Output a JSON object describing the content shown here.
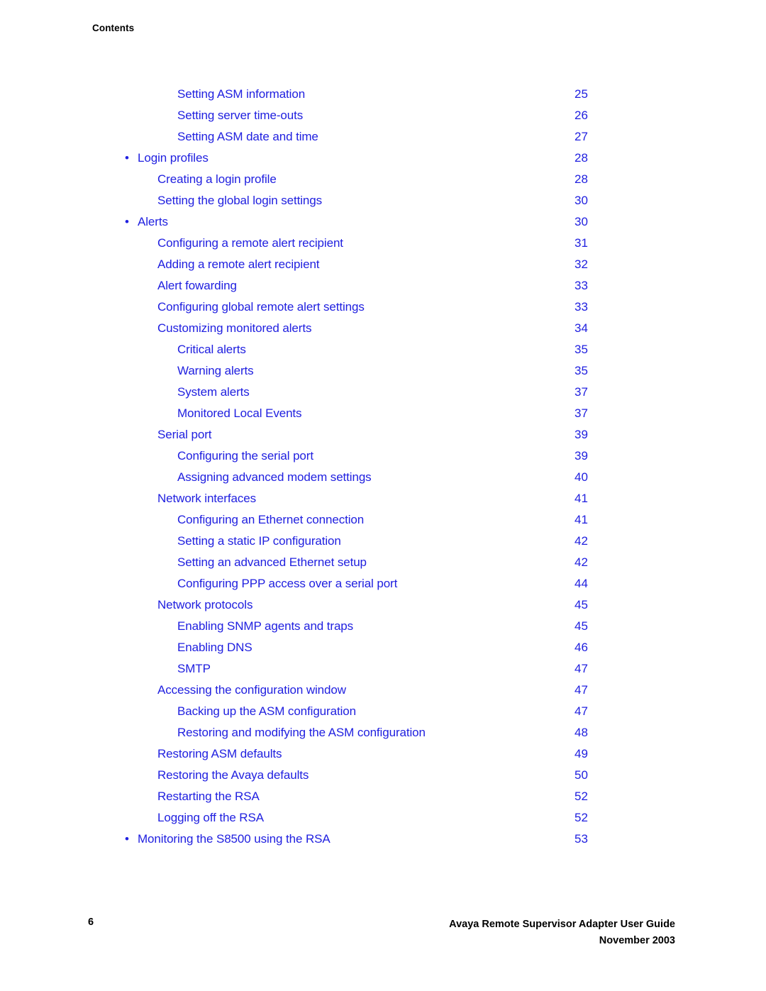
{
  "document": {
    "running_header": "Contents",
    "accent_color": "#2020e0",
    "text_color": "#000000"
  },
  "toc": {
    "entries": [
      {
        "title": "Setting ASM information",
        "page": "25",
        "level": 3,
        "bullet": false
      },
      {
        "title": "Setting server time-outs",
        "page": "26",
        "level": 3,
        "bullet": false
      },
      {
        "title": "Setting ASM date and time",
        "page": "27",
        "level": 3,
        "bullet": false
      },
      {
        "title": "Login profiles",
        "page": "28",
        "level": 1,
        "bullet": true
      },
      {
        "title": "Creating a login profile",
        "page": "28",
        "level": 2,
        "bullet": false
      },
      {
        "title": "Setting the global login settings",
        "page": "30",
        "level": 2,
        "bullet": false
      },
      {
        "title": "Alerts",
        "page": "30",
        "level": 1,
        "bullet": true
      },
      {
        "title": "Configuring a remote alert recipient",
        "page": "31",
        "level": 2,
        "bullet": false
      },
      {
        "title": "Adding a remote alert recipient",
        "page": "32",
        "level": 2,
        "bullet": false
      },
      {
        "title": "Alert fowarding",
        "page": "33",
        "level": 2,
        "bullet": false
      },
      {
        "title": "Configuring global remote alert settings",
        "page": "33",
        "level": 2,
        "bullet": false
      },
      {
        "title": "Customizing monitored alerts",
        "page": "34",
        "level": 2,
        "bullet": false
      },
      {
        "title": "Critical alerts",
        "page": "35",
        "level": 3,
        "bullet": false
      },
      {
        "title": "Warning alerts",
        "page": "35",
        "level": 3,
        "bullet": false
      },
      {
        "title": "System alerts",
        "page": "37",
        "level": 3,
        "bullet": false
      },
      {
        "title": "Monitored Local Events",
        "page": "37",
        "level": 3,
        "bullet": false
      },
      {
        "title": "Serial port",
        "page": "39",
        "level": 2,
        "bullet": false
      },
      {
        "title": "Configuring the serial port",
        "page": "39",
        "level": 3,
        "bullet": false
      },
      {
        "title": "Assigning advanced modem settings",
        "page": "40",
        "level": 3,
        "bullet": false
      },
      {
        "title": "Network interfaces",
        "page": "41",
        "level": 2,
        "bullet": false
      },
      {
        "title": "Configuring an Ethernet connection",
        "page": "41",
        "level": 3,
        "bullet": false
      },
      {
        "title": "Setting a static IP configuration",
        "page": "42",
        "level": 3,
        "bullet": false
      },
      {
        "title": "Setting an advanced Ethernet setup",
        "page": "42",
        "level": 3,
        "bullet": false
      },
      {
        "title": "Configuring PPP access over a serial port",
        "page": "44",
        "level": 3,
        "bullet": false
      },
      {
        "title": "Network protocols",
        "page": "45",
        "level": 2,
        "bullet": false
      },
      {
        "title": "Enabling SNMP agents and traps",
        "page": "45",
        "level": 3,
        "bullet": false
      },
      {
        "title": "Enabling DNS",
        "page": "46",
        "level": 3,
        "bullet": false
      },
      {
        "title": "SMTP",
        "page": "47",
        "level": 3,
        "bullet": false
      },
      {
        "title": "Accessing the configuration window",
        "page": "47",
        "level": 2,
        "bullet": false
      },
      {
        "title": "Backing up the ASM configuration",
        "page": "47",
        "level": 3,
        "bullet": false
      },
      {
        "title": "Restoring and modifying the ASM configuration",
        "page": "48",
        "level": 3,
        "bullet": false
      },
      {
        "title": "Restoring ASM defaults",
        "page": "49",
        "level": 2,
        "bullet": false
      },
      {
        "title": "Restoring the Avaya defaults",
        "page": "50",
        "level": 2,
        "bullet": false
      },
      {
        "title": "Restarting the RSA",
        "page": "52",
        "level": 2,
        "bullet": false
      },
      {
        "title": "Logging off the RSA",
        "page": "52",
        "level": 2,
        "bullet": false
      },
      {
        "title": "Monitoring the S8500 using the RSA",
        "page": "53",
        "level": 1,
        "bullet": true
      }
    ],
    "bullet_glyph": "•"
  },
  "footer": {
    "page_number": "6",
    "guide_title": "Avaya Remote Supervisor Adapter User Guide",
    "date": "November 2003"
  }
}
